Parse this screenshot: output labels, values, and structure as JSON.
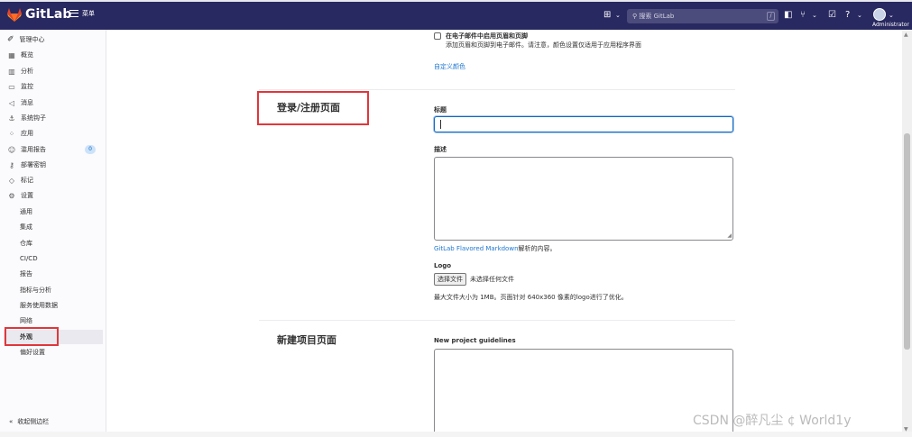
{
  "topbar": {
    "brand": "GitLab",
    "menu_label": "菜单",
    "search_placeholder": "搜索 GitLab",
    "search_shortcut": "/",
    "user_label": "Administrator"
  },
  "sidebar": {
    "header": "管理中心",
    "items": [
      {
        "label": "概览",
        "icon": "grid-icon"
      },
      {
        "label": "分析",
        "icon": "chart-icon"
      },
      {
        "label": "监控",
        "icon": "monitor-icon"
      },
      {
        "label": "消息",
        "icon": "megaphone-icon"
      },
      {
        "label": "系统钩子",
        "icon": "hook-icon"
      },
      {
        "label": "应用",
        "icon": "apps-icon"
      },
      {
        "label": "滥用报告",
        "icon": "emoji-icon",
        "badge": "0"
      },
      {
        "label": "部署密钥",
        "icon": "key-icon"
      },
      {
        "label": "标记",
        "icon": "label-icon"
      },
      {
        "label": "设置",
        "icon": "gear-icon"
      }
    ],
    "subitems": [
      "通用",
      "集成",
      "仓库",
      "CI/CD",
      "报告",
      "指标与分析",
      "服务使用数据",
      "网络",
      "外观",
      "偏好设置"
    ],
    "active_subitem": "外观",
    "collapse_label": "收起侧边栏"
  },
  "main": {
    "email_checkbox_label": "在电子邮件中启用页眉和页脚",
    "email_checkbox_help": "添加页眉和页脚到电子邮件。请注意，颜色设置仅适用于应用程序界面",
    "custom_color_link": "自定义颜色",
    "signin_section_title": "登录/注册页面",
    "title_label": "标题",
    "title_value": "",
    "description_label": "描述",
    "markdown_link": "GitLab Flavored Markdown",
    "markdown_suffix": "解析的内容。",
    "logo_label": "Logo",
    "file_button": "选择文件",
    "file_status": "未选择任何文件",
    "logo_help": "最大文件大小为 1MB。页面针对 640x360 像素的logo进行了优化。",
    "new_project_section_title": "新建项目页面",
    "new_project_label": "New project guidelines"
  },
  "watermark": "CSDN @醉凡尘 ¢ World1y",
  "colors": {
    "navbar": "#292961",
    "highlight_box": "#e0373c",
    "link": "#1f78d1"
  }
}
